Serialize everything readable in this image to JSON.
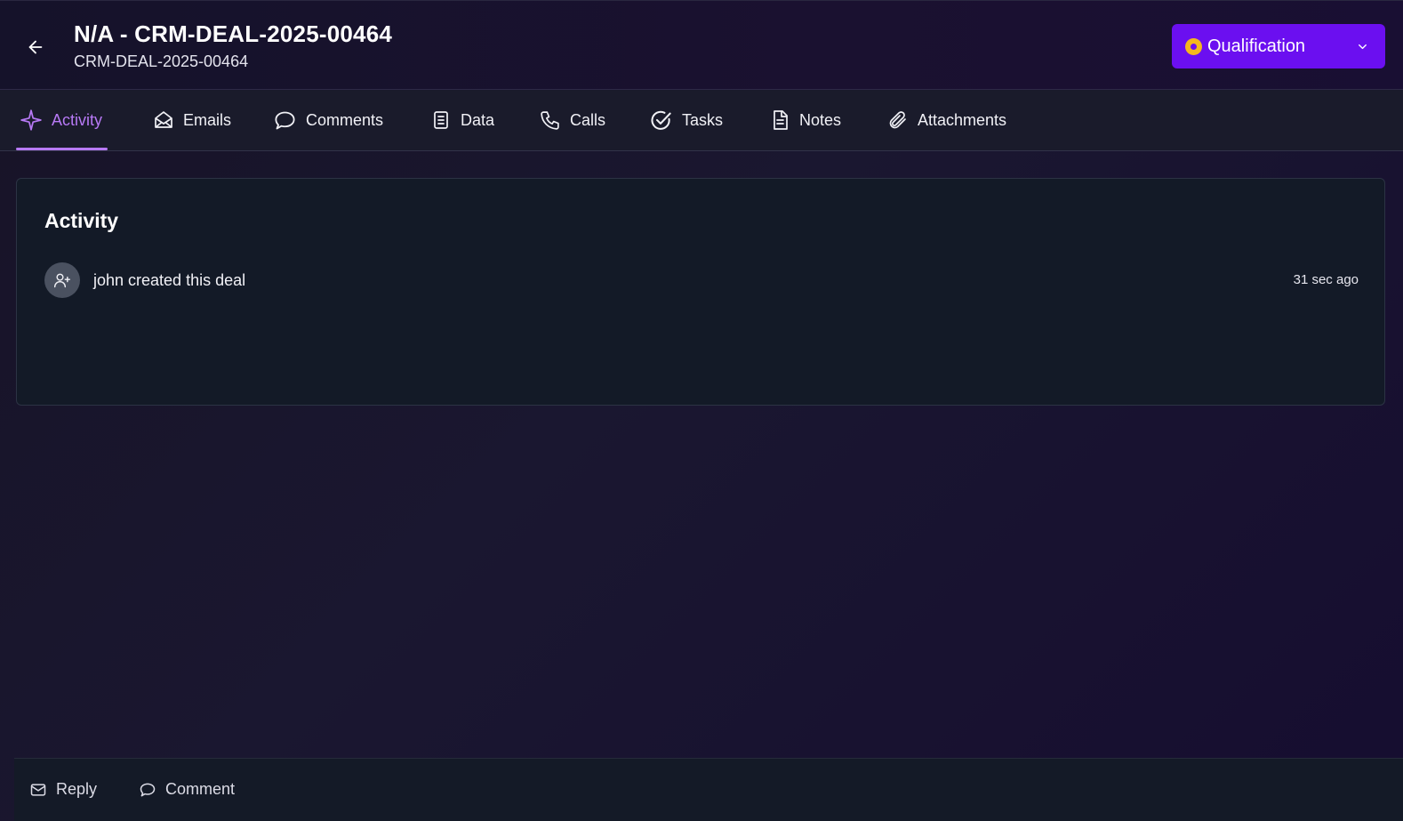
{
  "header": {
    "title": "N/A - CRM-DEAL-2025-00464",
    "subtitle": "CRM-DEAL-2025-00464",
    "status": {
      "label": "Qualification",
      "dot_color": "#f5b71e",
      "button_color": "#6b0ff0"
    }
  },
  "tabs": [
    {
      "label": "Activity",
      "icon": "sparkle-icon",
      "active": true
    },
    {
      "label": "Emails",
      "icon": "envelope-open-icon"
    },
    {
      "label": "Comments",
      "icon": "comment-icon"
    },
    {
      "label": "Data",
      "icon": "document-list-icon"
    },
    {
      "label": "Calls",
      "icon": "phone-icon"
    },
    {
      "label": "Tasks",
      "icon": "check-circle-icon"
    },
    {
      "label": "Notes",
      "icon": "note-icon"
    },
    {
      "label": "Attachments",
      "icon": "paperclip-icon"
    }
  ],
  "activity": {
    "title": "Activity",
    "items": [
      {
        "text": "john created this deal",
        "time": "31 sec ago",
        "icon": "user-plus-icon"
      }
    ]
  },
  "footer": {
    "reply_label": "Reply",
    "comment_label": "Comment"
  },
  "colors": {
    "accent": "#b779f5"
  }
}
